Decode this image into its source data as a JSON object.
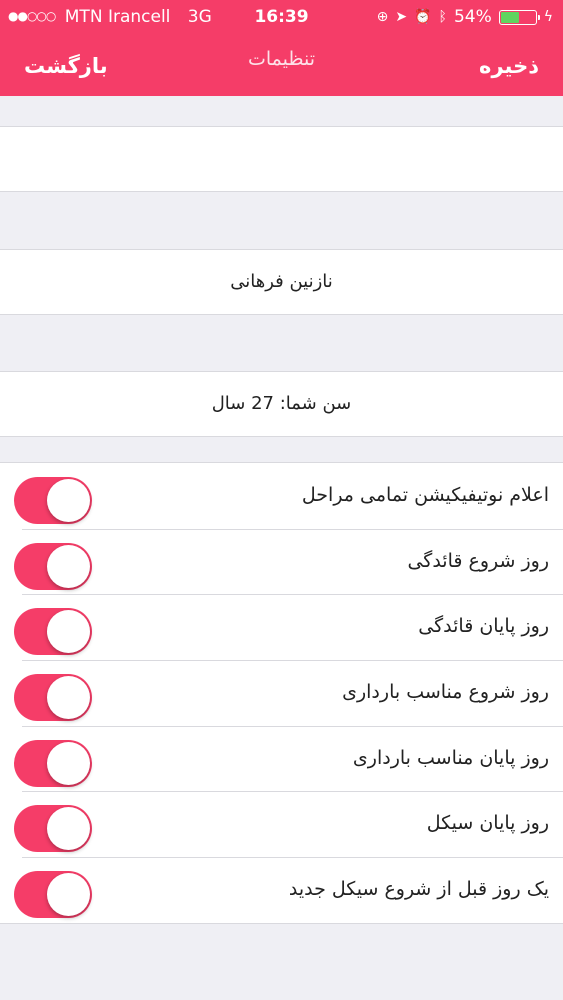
{
  "status_bar": {
    "signal_dots": "●●○○○",
    "carrier": "MTN Irancell",
    "network": "3G",
    "time": "16:39",
    "battery": "54%",
    "battery_level": 0.54,
    "battery_color": "#5fd45f"
  },
  "navbar": {
    "back_label": "بازگشت",
    "title": "تنظیمات",
    "save_label": "ذخیره"
  },
  "profile": {
    "name": "نازنین فرهانی",
    "age": "سن شما: 27 سال"
  },
  "toggles": [
    {
      "label": "اعلام نوتیفیکیشن تمامی مراحل",
      "on": true
    },
    {
      "label": "روز شروع قائدگی",
      "on": true
    },
    {
      "label": "روز پایان قائدگی",
      "on": true
    },
    {
      "label": "روز شروع مناسب بارداری",
      "on": true
    },
    {
      "label": "روز پایان مناسب بارداری",
      "on": true
    },
    {
      "label": "روز پایان سیکل",
      "on": true
    },
    {
      "label": "یک روز قبل از شروع سیکل جدید",
      "on": true
    }
  ],
  "colors": {
    "accent": "#f53d68",
    "background": "#efeff4"
  }
}
